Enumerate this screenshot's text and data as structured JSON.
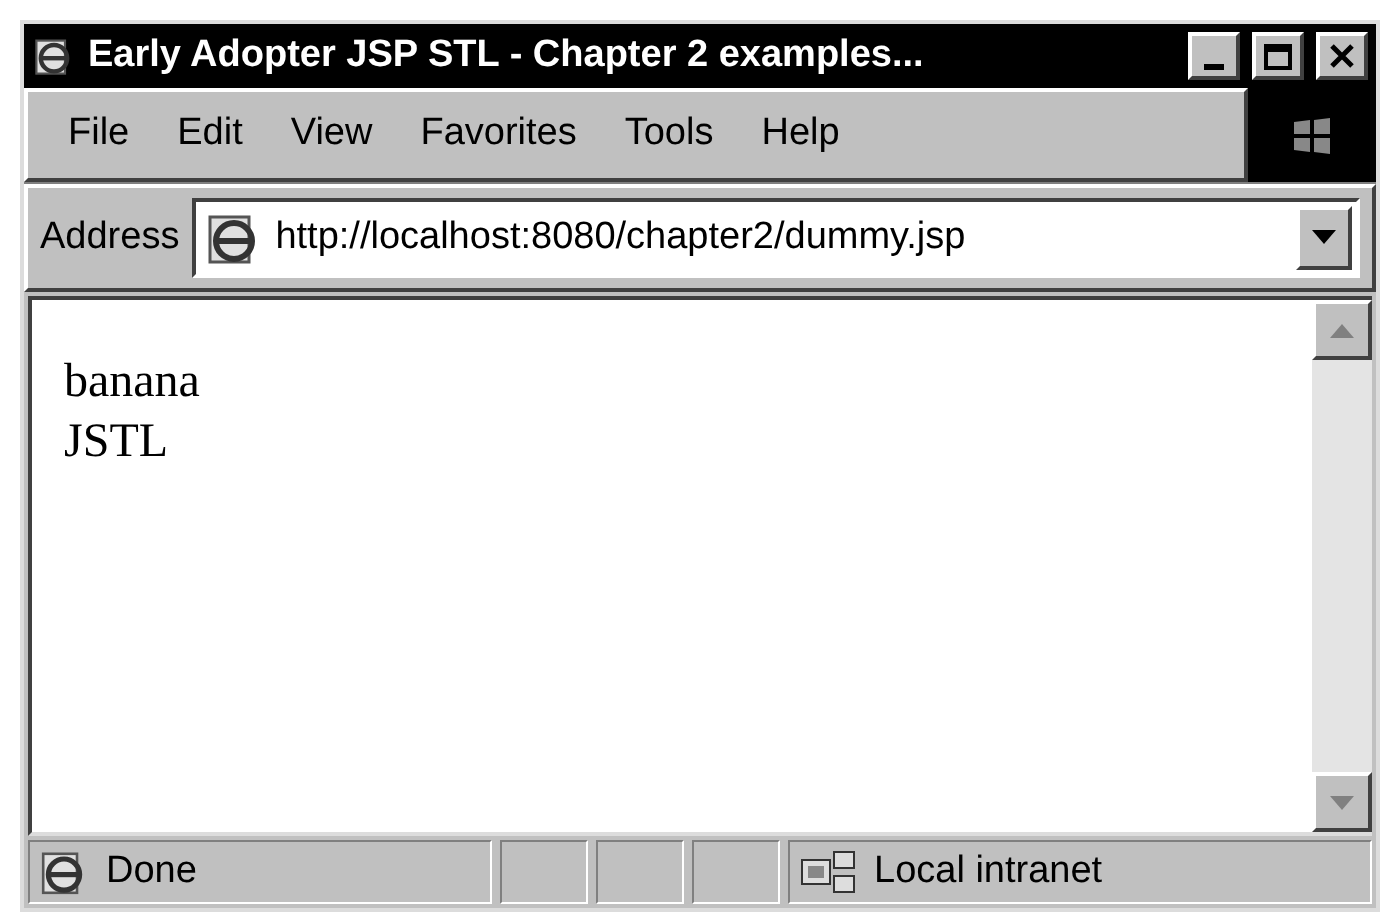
{
  "window": {
    "title": "Early Adopter JSP STL - Chapter 2 examples..."
  },
  "menu": [
    "File",
    "Edit",
    "View",
    "Favorites",
    "Tools",
    "Help"
  ],
  "address": {
    "label": "Address",
    "value": "http://localhost:8080/chapter2/dummy.jsp"
  },
  "content": {
    "lines": [
      "banana",
      "JSTL"
    ]
  },
  "status_bar": {
    "status": "Done",
    "zone": "Local intranet"
  }
}
